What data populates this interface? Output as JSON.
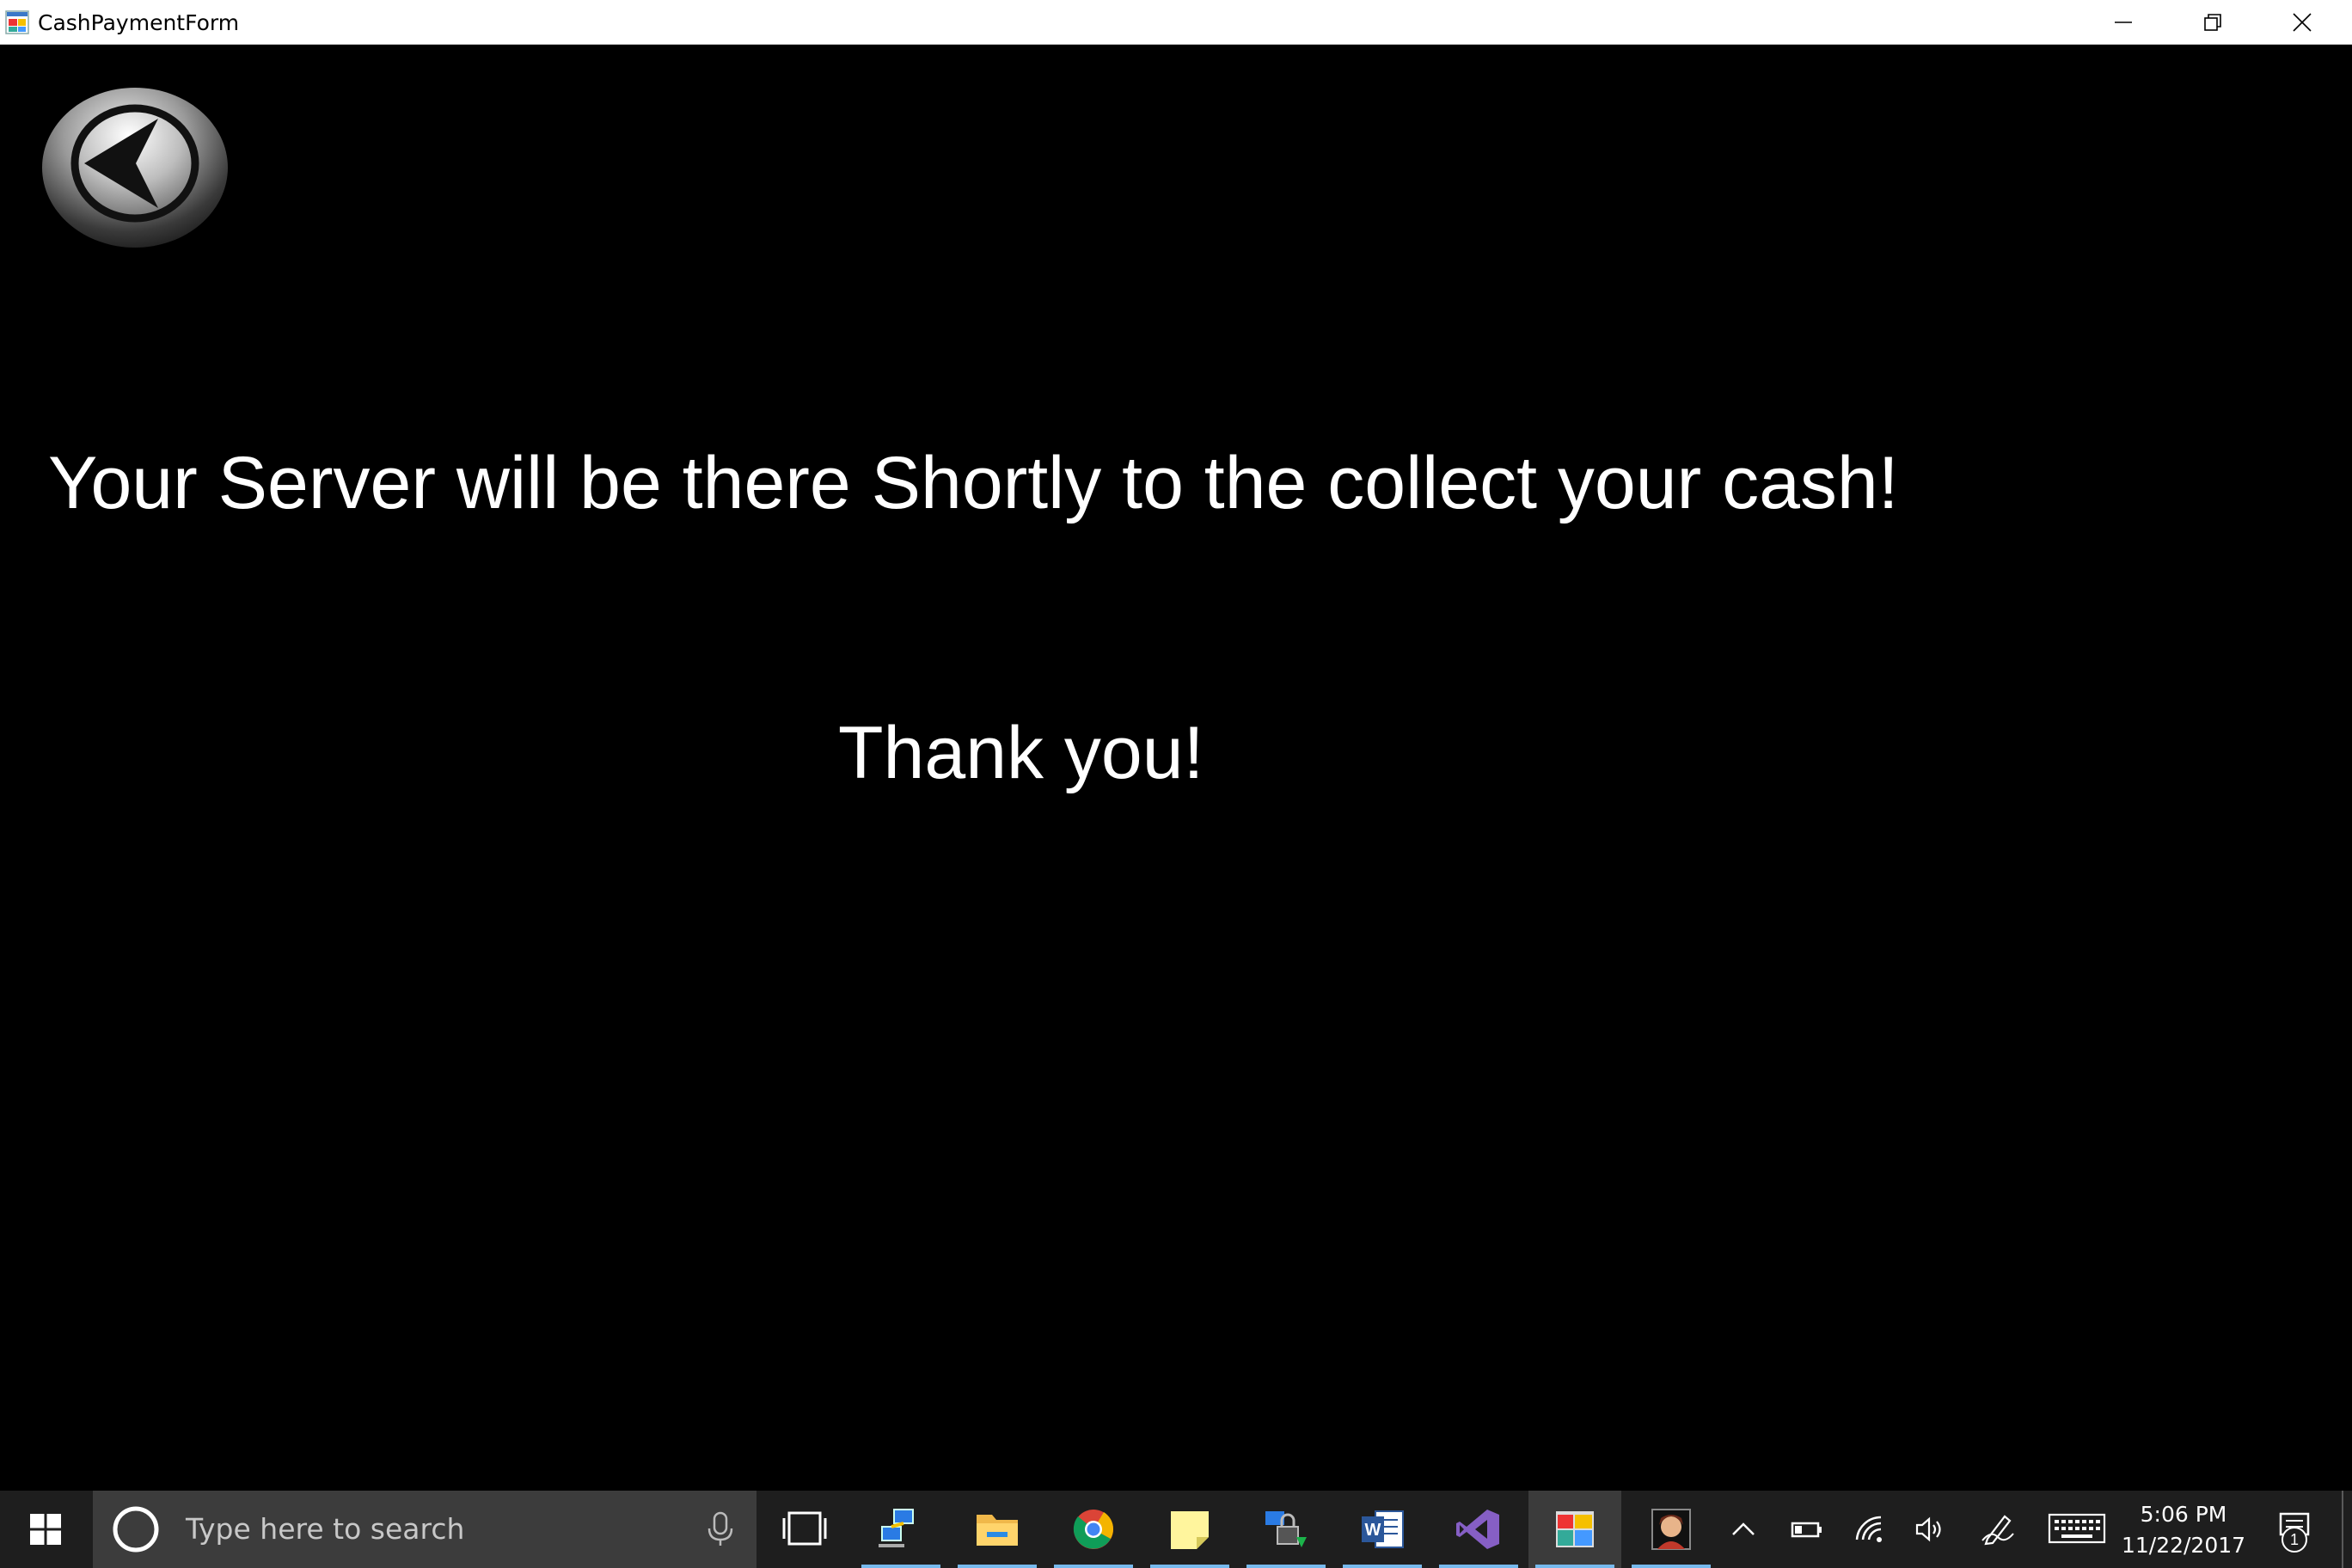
{
  "window": {
    "title": "CashPaymentForm",
    "icon": "app-form-icon",
    "controls": [
      "minimize-icon",
      "restore-icon",
      "close-icon"
    ]
  },
  "content": {
    "back_button_icon": "back-arrow-icon",
    "message": "Your Server will be there Shortly to the collect your cash!",
    "thank_you": "Thank you!"
  },
  "taskbar": {
    "search_placeholder": "Type here to search",
    "pinned": [
      {
        "name": "task-view",
        "icon": "task-view-icon"
      },
      {
        "name": "network-app",
        "icon": "network-icon"
      },
      {
        "name": "file-explorer",
        "icon": "folder-icon"
      },
      {
        "name": "chrome",
        "icon": "chrome-icon"
      },
      {
        "name": "sticky-notes",
        "icon": "sticky-note-icon"
      },
      {
        "name": "security-app",
        "icon": "lock-icon"
      },
      {
        "name": "word",
        "icon": "word-icon"
      },
      {
        "name": "visual-studio",
        "icon": "visual-studio-icon"
      },
      {
        "name": "cashpaymentform",
        "icon": "app-form-icon"
      },
      {
        "name": "photo-app",
        "icon": "avatar-icon"
      }
    ],
    "clock": {
      "time": "5:06 PM",
      "date": "11/22/2017"
    },
    "notification_count": "1"
  },
  "colors": {
    "background": "#000000",
    "text": "#ffffff",
    "taskbar": "#1e1e1e",
    "search": "#3c3c3c",
    "accent": "#76b9ed"
  }
}
